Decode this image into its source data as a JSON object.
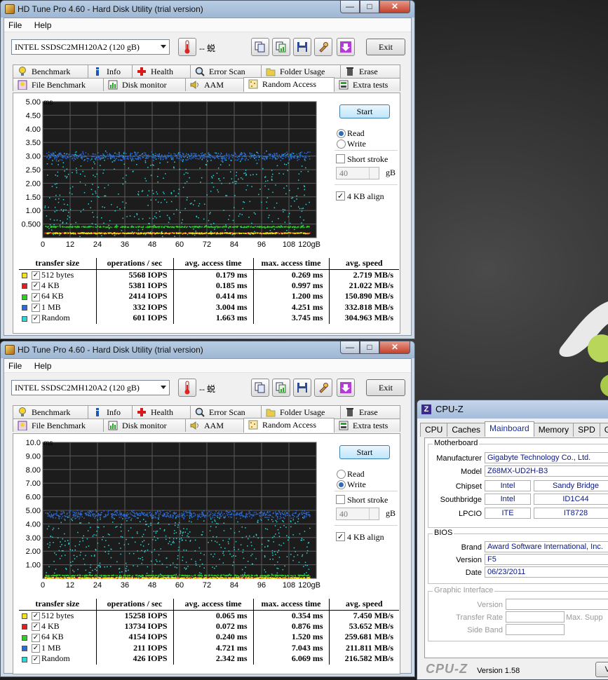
{
  "colors": {
    "yellow": "#f2e21a",
    "red": "#e31c1c",
    "green": "#2fcf22",
    "blue": "#2b6bd6",
    "cyan": "#29d8d6"
  },
  "win1": {
    "title": "HD Tune Pro 4.60 - Hard Disk Utility (trial version)",
    "menu": [
      "File",
      "Help"
    ],
    "drive": "INTEL SSDSC2MH120A2 (120 gB)",
    "temp": "-- 蜕",
    "exit": "Exit",
    "tabs_row1": [
      "Benchmark",
      "Info",
      "Health",
      "Error Scan",
      "Folder Usage",
      "Erase"
    ],
    "tabs_row2": [
      "File Benchmark",
      "Disk monitor",
      "AAM",
      "Random Access",
      "Extra tests"
    ],
    "start": "Start",
    "read": "Read",
    "write": "Write",
    "mode": "read",
    "short_stroke": "Short stroke",
    "stroke_value": "40",
    "gb": "gB",
    "align": "4 KB align",
    "chart_data": {
      "type": "scatter",
      "ylabel": "ms",
      "xlabel": "gB",
      "yticks": [
        "5.00",
        "4.50",
        "4.00",
        "3.50",
        "3.00",
        "2.50",
        "2.00",
        "1.50",
        "1.00",
        "0.500"
      ],
      "ymax": 5.0,
      "xticks": [
        "0",
        "12",
        "24",
        "36",
        "48",
        "60",
        "72",
        "84",
        "96",
        "108",
        "120gB"
      ],
      "xmax": 120,
      "series": [
        {
          "name": "512 bytes",
          "color": "yellow",
          "avg": 0.179
        },
        {
          "name": "4 KB",
          "color": "red",
          "avg": 0.185
        },
        {
          "name": "64 KB",
          "color": "green",
          "avg": 0.414
        },
        {
          "name": "1 MB",
          "color": "blue",
          "avg": 3.004
        },
        {
          "name": "Random",
          "color": "cyan",
          "avg": 1.663
        }
      ]
    },
    "table": {
      "headers": [
        "transfer size",
        "operations / sec",
        "avg. access time",
        "max. access time",
        "avg. speed"
      ],
      "rows": [
        {
          "label": "512 bytes",
          "ops": "5568 IOPS",
          "avg": "0.179 ms",
          "max": "0.269 ms",
          "speed": "2.719 MB/s"
        },
        {
          "label": "4 KB",
          "ops": "5381 IOPS",
          "avg": "0.185 ms",
          "max": "0.997 ms",
          "speed": "21.022 MB/s"
        },
        {
          "label": "64 KB",
          "ops": "2414 IOPS",
          "avg": "0.414 ms",
          "max": "1.200 ms",
          "speed": "150.890 MB/s"
        },
        {
          "label": "1 MB",
          "ops": "332 IOPS",
          "avg": "3.004 ms",
          "max": "4.251 ms",
          "speed": "332.818 MB/s"
        },
        {
          "label": "Random",
          "ops": "601 IOPS",
          "avg": "1.663 ms",
          "max": "3.745 ms",
          "speed": "304.963 MB/s"
        }
      ]
    }
  },
  "win2": {
    "title": "HD Tune Pro 4.60 - Hard Disk Utility (trial version)",
    "menu": [
      "File",
      "Help"
    ],
    "drive": "INTEL SSDSC2MH120A2 (120 gB)",
    "temp": "-- 蜕",
    "exit": "Exit",
    "tabs_row1": [
      "Benchmark",
      "Info",
      "Health",
      "Error Scan",
      "Folder Usage",
      "Erase"
    ],
    "tabs_row2": [
      "File Benchmark",
      "Disk monitor",
      "AAM",
      "Random Access",
      "Extra tests"
    ],
    "start": "Start",
    "read": "Read",
    "write": "Write",
    "mode": "write",
    "short_stroke": "Short stroke",
    "stroke_value": "40",
    "gb": "gB",
    "align": "4 KB align",
    "chart_data": {
      "type": "scatter",
      "ylabel": "ms",
      "xlabel": "gB",
      "yticks": [
        "10.0",
        "9.00",
        "8.00",
        "7.00",
        "6.00",
        "5.00",
        "4.00",
        "3.00",
        "2.00",
        "1.00"
      ],
      "ymax": 10.0,
      "xticks": [
        "0",
        "12",
        "24",
        "36",
        "48",
        "60",
        "72",
        "84",
        "96",
        "108",
        "120gB"
      ],
      "xmax": 120,
      "series": [
        {
          "name": "512 bytes",
          "color": "yellow",
          "avg": 0.065
        },
        {
          "name": "4 KB",
          "color": "red",
          "avg": 0.072
        },
        {
          "name": "64 KB",
          "color": "green",
          "avg": 0.24
        },
        {
          "name": "1 MB",
          "color": "blue",
          "avg": 4.721
        },
        {
          "name": "Random",
          "color": "cyan",
          "avg": 2.342
        }
      ]
    },
    "table": {
      "headers": [
        "transfer size",
        "operations / sec",
        "avg. access time",
        "max. access time",
        "avg. speed"
      ],
      "rows": [
        {
          "label": "512 bytes",
          "ops": "15258 IOPS",
          "avg": "0.065 ms",
          "max": "0.354 ms",
          "speed": "7.450 MB/s"
        },
        {
          "label": "4 KB",
          "ops": "13734 IOPS",
          "avg": "0.072 ms",
          "max": "0.876 ms",
          "speed": "53.652 MB/s"
        },
        {
          "label": "64 KB",
          "ops": "4154 IOPS",
          "avg": "0.240 ms",
          "max": "1.520 ms",
          "speed": "259.681 MB/s"
        },
        {
          "label": "1 MB",
          "ops": "211 IOPS",
          "avg": "4.721 ms",
          "max": "7.043 ms",
          "speed": "211.811 MB/s"
        },
        {
          "label": "Random",
          "ops": "426 IOPS",
          "avg": "2.342 ms",
          "max": "6.069 ms",
          "speed": "216.582 MB/s"
        }
      ]
    }
  },
  "cpuz": {
    "title": "CPU-Z",
    "tabs": [
      "CPU",
      "Caches",
      "Mainboard",
      "Memory",
      "SPD",
      "Gra"
    ],
    "motherboard": {
      "group": "Motherboard",
      "manufacturer_label": "Manufacturer",
      "manufacturer": "Gigabyte Technology Co., Ltd.",
      "model_label": "Model",
      "model": "Z68MX-UD2H-B3",
      "chipset_label": "Chipset",
      "chipset_vendor": "Intel",
      "chipset": "Sandy Bridge",
      "southbridge_label": "Southbridge",
      "southbridge_vendor": "Intel",
      "southbridge": "ID1C44",
      "lpcio_label": "LPCIO",
      "lpcio_vendor": "ITE",
      "lpcio": "IT8728"
    },
    "bios": {
      "group": "BIOS",
      "brand_label": "Brand",
      "brand": "Award Software International, Inc.",
      "version_label": "Version",
      "version": "F5",
      "date_label": "Date",
      "date": "06/23/2011"
    },
    "graphic": {
      "group": "Graphic Interface",
      "version_label": "Version",
      "transfer_label": "Transfer Rate",
      "max_label": "Max. Supp",
      "sideband_label": "Side Band"
    },
    "footer_brand": "CPU-Z",
    "footer_version": "Version 1.58",
    "footer_btn": "Va"
  }
}
